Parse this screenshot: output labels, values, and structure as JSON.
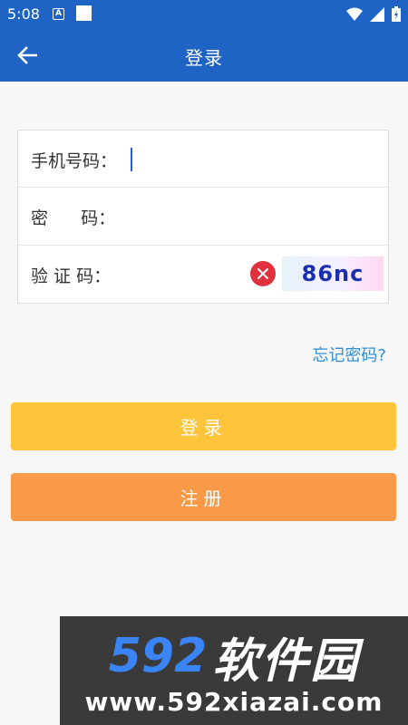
{
  "status_bar": {
    "time": "5:08",
    "a_icon": "A",
    "icons": [
      "a-box-icon",
      "square-icon",
      "wifi-icon",
      "signal-icon",
      "battery-icon"
    ]
  },
  "app_bar": {
    "back_icon": "arrow-left-icon",
    "title": "登录"
  },
  "form": {
    "phone": {
      "label": "手机号码：",
      "value": ""
    },
    "password": {
      "label": "密      码：",
      "value": ""
    },
    "captcha": {
      "label": "验 证 码：",
      "value": "",
      "image_text": "86nc",
      "clear_icon": "close-circle-icon"
    }
  },
  "forgot_password": "忘记密码?",
  "buttons": {
    "login": "登录",
    "register": "注册"
  },
  "watermark": {
    "brand_number": "592",
    "brand_text": "软件园",
    "url": "www.592xiazai.com"
  },
  "colors": {
    "primary": "#1f63c4",
    "login_button": "#fec53a",
    "register_button": "#f99a48",
    "link": "#2f8fd6",
    "clear": "#e0323e"
  }
}
